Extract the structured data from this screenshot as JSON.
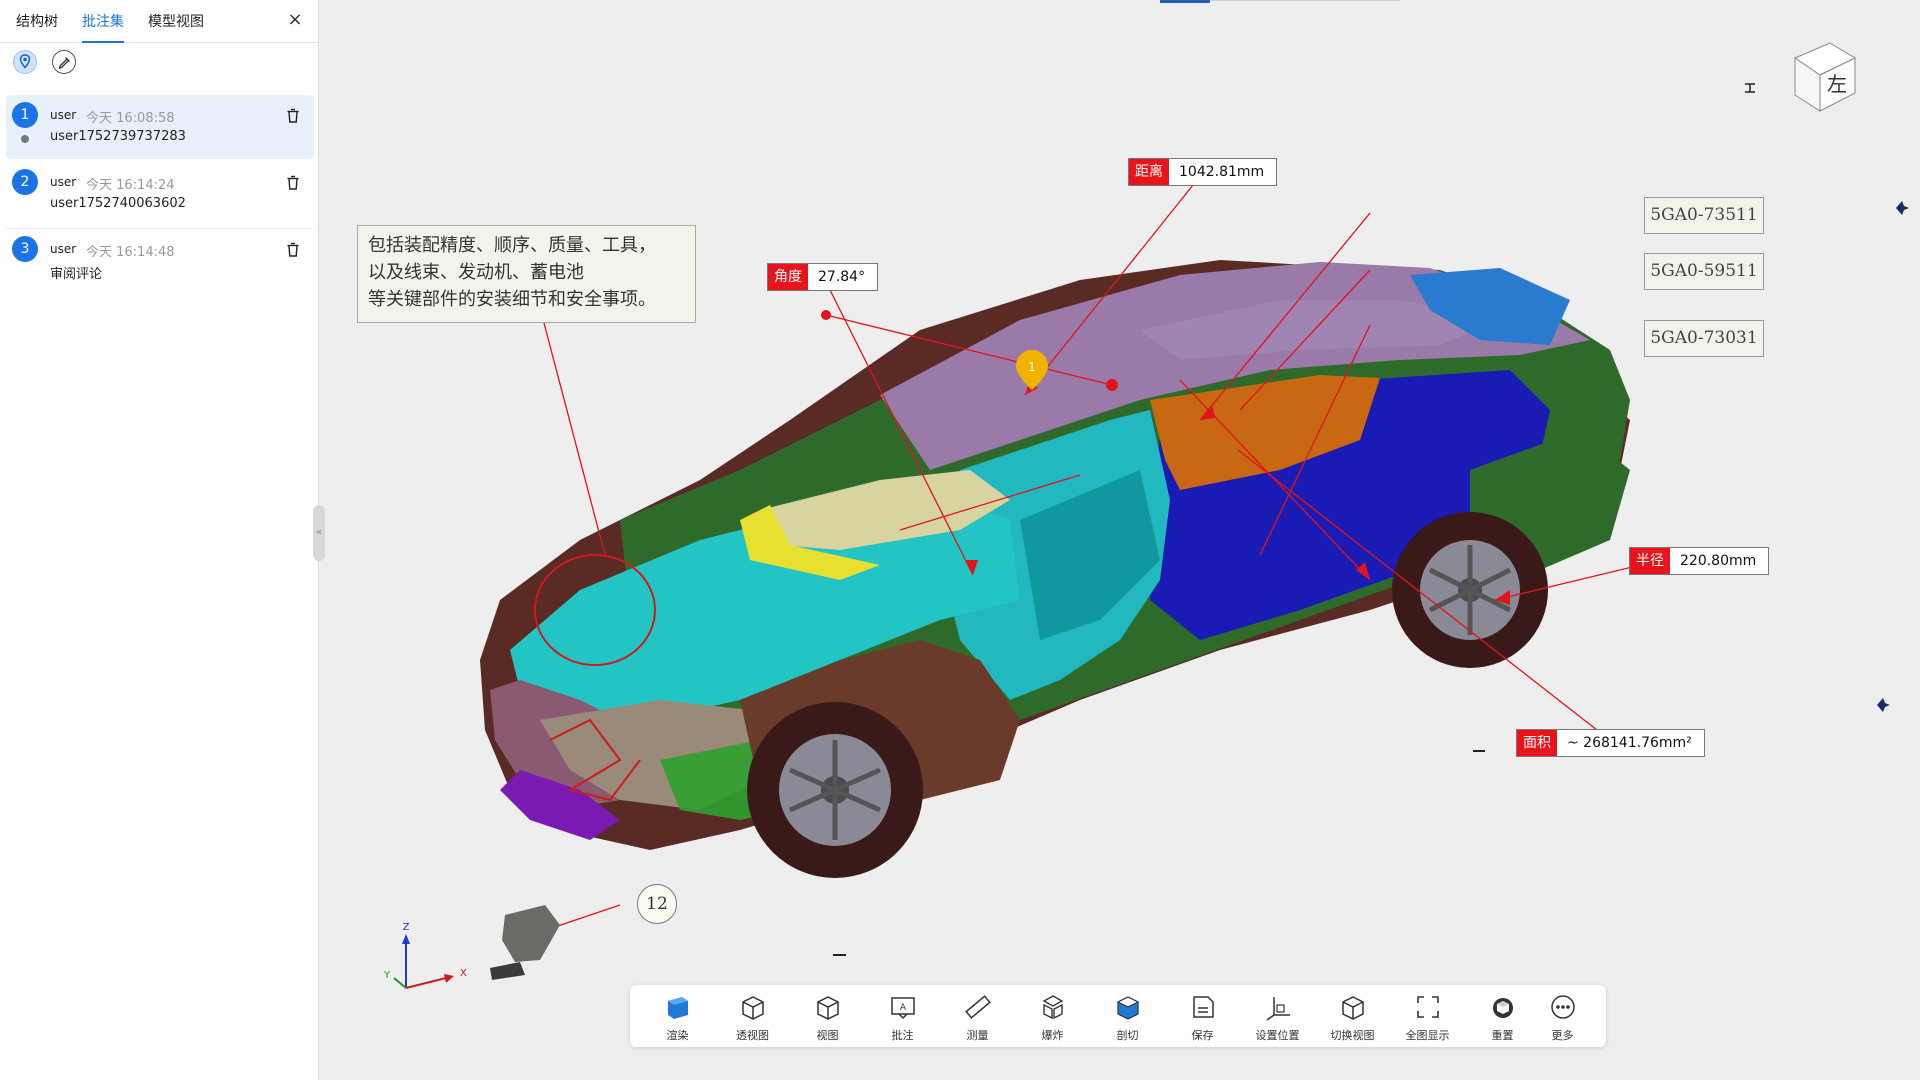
{
  "panel": {
    "tabs": [
      {
        "label": "结构树"
      },
      {
        "label": "批注集"
      },
      {
        "label": "模型视图"
      }
    ],
    "close_icon": "×",
    "icons": {
      "pin": "location-pin-icon",
      "edit": "pen-edit-icon"
    },
    "annotations": [
      {
        "num": "1",
        "user": "user",
        "time": "今天 16:08:58",
        "content": "user1752739737283"
      },
      {
        "num": "2",
        "user": "user",
        "time": "今天 16:14:24",
        "content": "user1752740063602"
      },
      {
        "num": "3",
        "user": "user",
        "time": "今天 16:14:48",
        "content": "审阅评论"
      }
    ],
    "collapse_glyph": "«"
  },
  "viewport": {
    "note_text": "包括装配精度、顺序、质量、工具，\n以及线束、发动机、蓄电池\n等关键部件的安装细节和安全事项。",
    "part_tags": [
      "5GA0-73511",
      "5GA0-59511",
      "5GA0-73031"
    ],
    "measurements": {
      "distance": {
        "label": "距离",
        "value": "1042.81mm"
      },
      "angle": {
        "label": "角度",
        "value": "27.84°"
      },
      "radius": {
        "label": "半径",
        "value": "220.80mm"
      },
      "area": {
        "label": "面积",
        "value": "~ 268141.76mm²"
      }
    },
    "balloon": "12",
    "pin_marker": "1",
    "view_cube_face": "左",
    "axis_labels": {
      "x": "X",
      "y": "Y",
      "z": "Z"
    }
  },
  "toolbar": {
    "buttons": [
      {
        "label": "渲染",
        "icon": "render-icon"
      },
      {
        "label": "透视图",
        "icon": "perspective-icon"
      },
      {
        "label": "视图",
        "icon": "view-icon"
      },
      {
        "label": "批注",
        "icon": "annotate-icon"
      },
      {
        "label": "测量",
        "icon": "measure-icon"
      },
      {
        "label": "爆炸",
        "icon": "explode-icon"
      },
      {
        "label": "剖切",
        "icon": "section-icon"
      },
      {
        "label": "保存",
        "icon": "save-icon"
      },
      {
        "label": "设置位置",
        "icon": "set-position-icon"
      },
      {
        "label": "切换视图",
        "icon": "switch-view-icon"
      },
      {
        "label": "全图显示",
        "icon": "fit-all-icon"
      },
      {
        "label": "重置",
        "icon": "reset-icon"
      },
      {
        "label": "更多",
        "icon": "more-icon"
      }
    ]
  },
  "colors": {
    "accent": "#1976d2",
    "badge": "#1a73e8",
    "measure_label": "#e8141b",
    "selected_row": "#e8f1fb"
  }
}
